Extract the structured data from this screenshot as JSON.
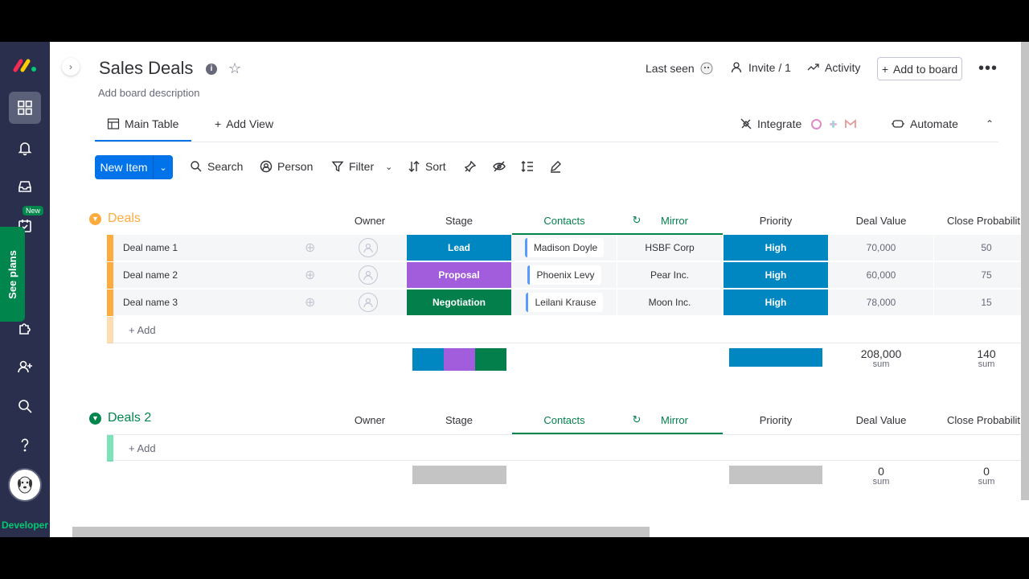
{
  "rail": {
    "new_badge": "New",
    "see_plans": "See plans",
    "developer_label": "Developer"
  },
  "header": {
    "title": "Sales Deals",
    "description": "Add board description",
    "last_seen": "Last seen",
    "invite": "Invite / 1",
    "activity": "Activity",
    "add_to_board": "Add to board"
  },
  "views": {
    "main_table": "Main Table",
    "add_view": "Add View",
    "integrate": "Integrate",
    "automate": "Automate"
  },
  "toolbar": {
    "new_item": "New Item",
    "search": "Search",
    "person": "Person",
    "filter": "Filter",
    "sort": "Sort"
  },
  "columns": {
    "owner": "Owner",
    "stage": "Stage",
    "contacts": "Contacts",
    "mirror": "Mirror",
    "priority": "Priority",
    "deal_value": "Deal Value",
    "close_probability": "Close Probabilit"
  },
  "group1": {
    "title": "Deals",
    "color": "#fdab3d",
    "rows": [
      {
        "name": "Deal name 1",
        "stage": "Lead",
        "stage_color": "#0086c0",
        "contact": "Madison Doyle",
        "mirror": "HSBF Corp",
        "priority": "High",
        "priority_color": "#0086c0",
        "deal_value": "70,000",
        "close_prob": "50"
      },
      {
        "name": "Deal name 2",
        "stage": "Proposal",
        "stage_color": "#a25ddc",
        "contact": "Phoenix Levy",
        "mirror": "Pear Inc.",
        "priority": "High",
        "priority_color": "#0086c0",
        "deal_value": "60,000",
        "close_prob": "75"
      },
      {
        "name": "Deal name 3",
        "stage": "Negotiation",
        "stage_color": "#037f4c",
        "contact": "Leilani Krause",
        "mirror": "Moon Inc.",
        "priority": "High",
        "priority_color": "#0086c0",
        "deal_value": "78,000",
        "close_prob": "15"
      }
    ],
    "add_label": "+ Add",
    "sum_deal_value": "208,000",
    "sum_close_prob": "140",
    "sum_label": "sum"
  },
  "group2": {
    "title": "Deals 2",
    "color": "#00c875",
    "add_label": "+ Add",
    "sum_deal_value": "0",
    "sum_close_prob": "0",
    "sum_label": "sum"
  }
}
